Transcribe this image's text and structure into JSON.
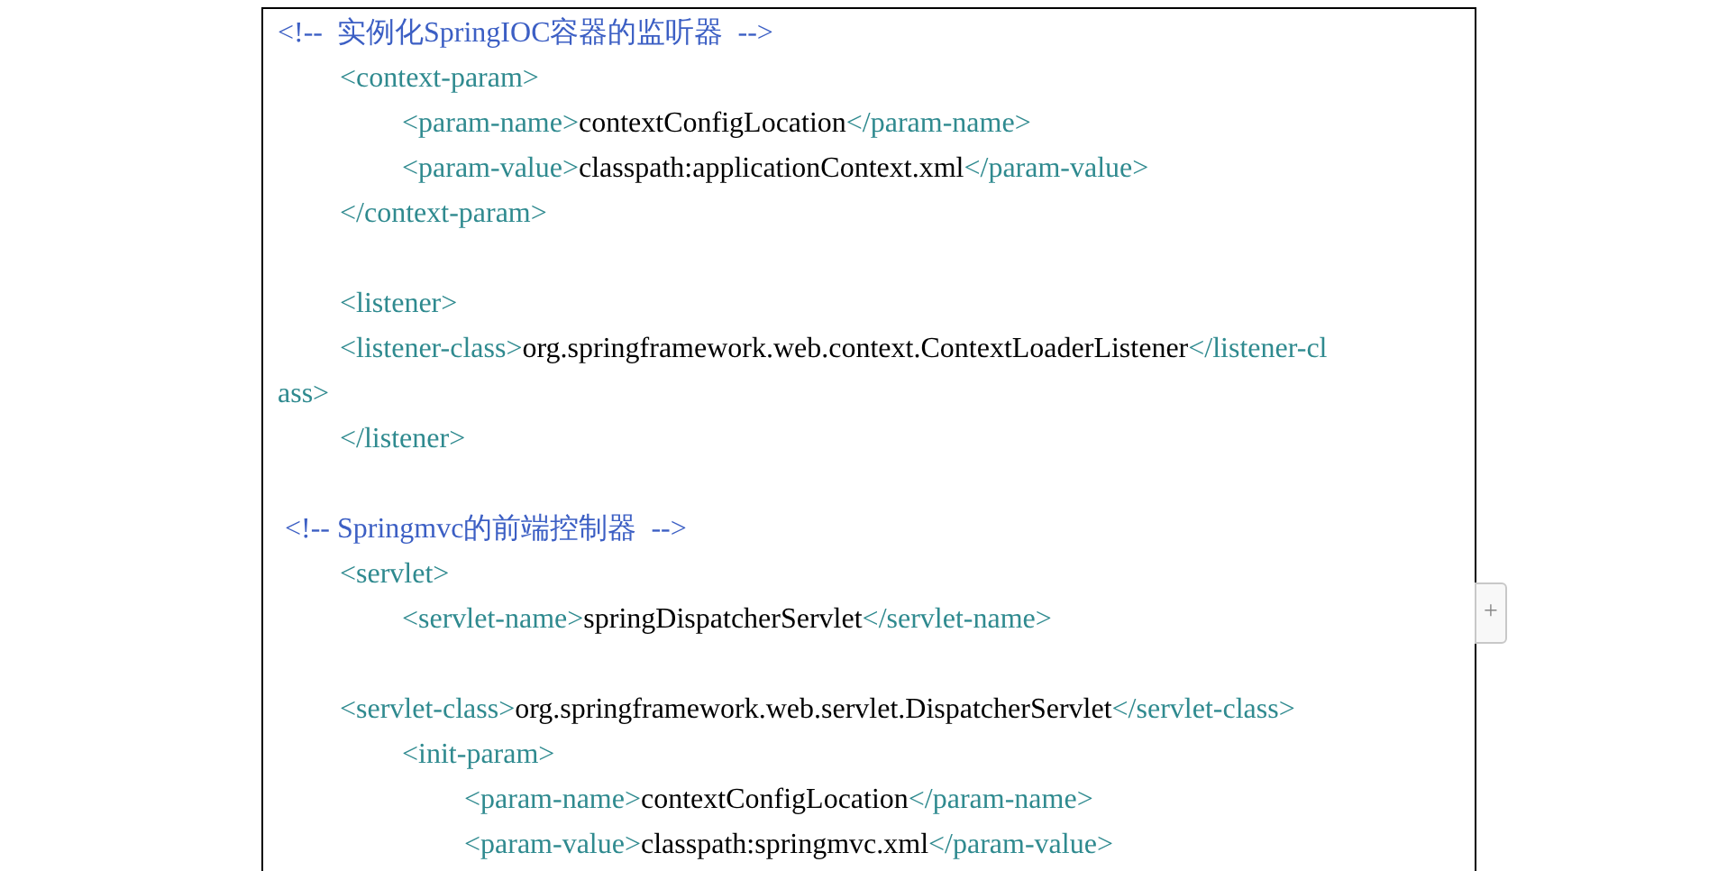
{
  "code_lines": [
    {
      "parts": [
        {
          "kind": "comment",
          "text": "<!--  实例化SpringIOC容器的监听器  -->"
        }
      ],
      "children": [
        {
          "parts": [
            {
              "kind": "tag",
              "text": "<context-param>"
            }
          ],
          "children": [
            {
              "parts": [
                {
                  "kind": "tag",
                  "text": "<param-name>"
                },
                {
                  "kind": "text",
                  "text": "contextConfigLocation"
                },
                {
                  "kind": "tag",
                  "text": "</param-name>"
                }
              ]
            },
            {
              "parts": [
                {
                  "kind": "tag",
                  "text": "<param-value>"
                },
                {
                  "kind": "text",
                  "text": "classpath:applicationContext.xml"
                },
                {
                  "kind": "tag",
                  "text": "</param-value>"
                }
              ]
            }
          ]
        },
        {
          "parts": [
            {
              "kind": "tag",
              "text": "</context-param>"
            }
          ]
        },
        {
          "kind": "blank"
        },
        {
          "parts": [
            {
              "kind": "tag",
              "text": "<listener>"
            }
          ]
        },
        {
          "parts": [
            {
              "kind": "tag",
              "text": "<listener-class>"
            },
            {
              "kind": "text",
              "text": "org.springframework.web.context.ContextLoaderListener"
            },
            {
              "kind": "tag",
              "text": "</listener-cl"
            }
          ],
          "continuation": "ass>"
        },
        {
          "parts": [
            {
              "kind": "tag",
              "text": "</listener>"
            }
          ]
        },
        {
          "kind": "blank"
        }
      ]
    },
    {
      "parts": [
        {
          "kind": "comment",
          "text": " <!-- Springmvc的前端控制器  -->"
        }
      ],
      "children": [
        {
          "parts": [
            {
              "kind": "tag",
              "text": "<servlet>"
            }
          ],
          "children": [
            {
              "parts": [
                {
                  "kind": "tag",
                  "text": "<servlet-name>"
                },
                {
                  "kind": "text",
                  "text": "springDispatcherServlet"
                },
                {
                  "kind": "tag",
                  "text": "</servlet-name>"
                }
              ]
            }
          ]
        },
        {
          "kind": "blank"
        },
        {
          "parts": [
            {
              "kind": "tag",
              "text": "<servlet-class>"
            },
            {
              "kind": "text",
              "text": "org.springframework.web.servlet.DispatcherServlet"
            },
            {
              "kind": "tag",
              "text": "</servlet-class>"
            }
          ],
          "children": [
            {
              "parts": [
                {
                  "kind": "tag",
                  "text": "<init-param>"
                }
              ],
              "children": [
                {
                  "parts": [
                    {
                      "kind": "tag",
                      "text": "<param-name>"
                    },
                    {
                      "kind": "text",
                      "text": "contextConfigLocation"
                    },
                    {
                      "kind": "tag",
                      "text": "</param-name>"
                    }
                  ]
                },
                {
                  "parts": [
                    {
                      "kind": "tag",
                      "text": "<param-value>"
                    },
                    {
                      "kind": "text",
                      "text": "classpath:springmvc.xml"
                    },
                    {
                      "kind": "tag",
                      "text": "</param-value>"
                    }
                  ]
                }
              ]
            }
          ]
        }
      ]
    }
  ],
  "add_row_button": "+"
}
